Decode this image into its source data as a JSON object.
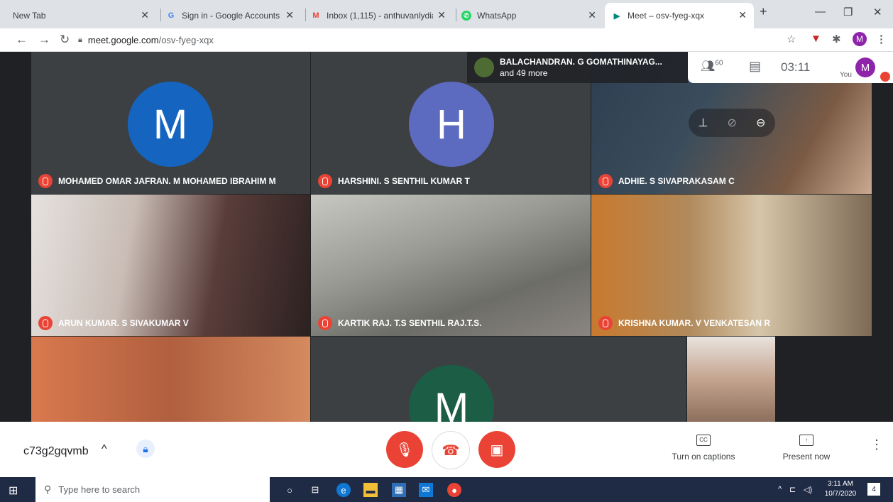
{
  "browser": {
    "tabs": [
      {
        "label": "New Tab",
        "favicon": "none"
      },
      {
        "label": "Sign in - Google Accounts",
        "favicon": "google-icon"
      },
      {
        "label": "Inbox (1,115) - anthuvanlydia-",
        "favicon": "gmail-icon"
      },
      {
        "label": "WhatsApp",
        "favicon": "whatsapp-icon"
      },
      {
        "label": "Meet – osv-fyeg-xqx",
        "favicon": "meet-icon"
      }
    ],
    "address": {
      "domain": "meet.google.com",
      "path": "/osv-fyeg-xqx"
    },
    "profile_initial": "M"
  },
  "meet": {
    "overlay": {
      "line1": "BALACHANDRAN. G GOMATHINAYAG...",
      "line2": "and 49 more"
    },
    "participant_count": "60",
    "clock": "03:11",
    "you_label": "You",
    "you_initial": "M",
    "tiles": [
      {
        "name": "MOHAMED OMAR JAFRAN. M MOHAMED IBRAHIM M",
        "avatar": "M",
        "avatar_color": "#1565c0"
      },
      {
        "name": "HARSHINI. S SENTHIL KUMAR T",
        "avatar": "H",
        "avatar_color": "#5c6bc0"
      },
      {
        "name": "ADHIE. S SIVAPRAKASAM C",
        "avatar": "",
        "avatar_color": ""
      },
      {
        "name": "ARUN KUMAR. S SIVAKUMAR V",
        "avatar": "",
        "avatar_color": ""
      },
      {
        "name": "KARTIK RAJ. T.S SENTHIL RAJ.T.S.",
        "avatar": "",
        "avatar_color": ""
      },
      {
        "name": "KRISHNA KUMAR. V VENKATESAN R",
        "avatar": "",
        "avatar_color": ""
      },
      {
        "name": "",
        "avatar": "",
        "avatar_color": ""
      },
      {
        "name": "",
        "avatar": "M",
        "avatar_color": "#1b5e45"
      },
      {
        "name": "",
        "avatar": "",
        "avatar_color": ""
      }
    ]
  },
  "bottom": {
    "meeting_code": "c73g2gqvmb",
    "captions_label": "Turn on captions",
    "present_label": "Present now"
  },
  "taskbar": {
    "search_placeholder": "Type here to search",
    "time": "3:11 AM",
    "date": "10/7/2020",
    "notifications": "4"
  },
  "colors": {
    "mute_red": "#ea4335",
    "meet_bg": "#202124"
  }
}
